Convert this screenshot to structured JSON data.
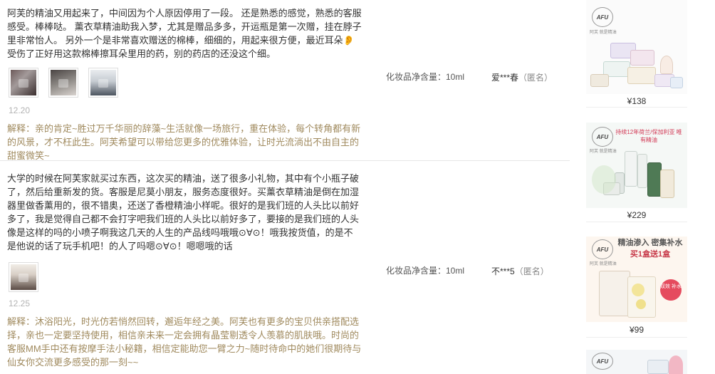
{
  "reviews": [
    {
      "content": "阿芙的精油又用起来了，中间因为个人原因停用了一段。 还是熟悉的感觉，熟悉的客服感受。棒棒哒。 薰衣草精油助我入梦，尤其是赠品多多，开运瓶是第一次赠，挂在脖子里非常怡人。 另外一个是非常喜欢赠送的棉棒，细细的，用起来很方便，最近耳朵👂受伤了正好用这款棉棒擦耳朵里用的药，别的药店的还没这个细。",
      "date": "12.20",
      "explanation": "解释：亲的肯定~胜过万千华丽的辞藻~生活就像一场旅行，重在体验，每个转角都有新的风景，才不枉此生。阿芙希望可以带给您更多的优雅体验，让时光流淌出不由自主的甜蜜微笑~",
      "spec": "化妆品净含量：10ml",
      "user": "爱***春",
      "anon": "（匿名）"
    },
    {
      "content": "大学的时候在阿芙家就买过东西，这次买的精油，送了很多小礼物，其中有个小瓶子破了，然后给重新发的货。客服是尼莫小朋友，服务态度很好。买薰衣草精油是倒在加湿器里做香薰用的，很不错奥，还送了香橙精油小样呢。很好的是我们班的人头比以前好多了，我是觉得自己都不会打字吧我们班的人头比以前好多了，要接的是我们班的人头像是这样的吗的小喷子啊我这几天的人生的产品线吗哦哦⊙∀⊙！哦我按货值，的是不是他说的话了玩手机吧！的人了吗嗯⊙∀⊙！嗯嗯哦的话",
      "date": "12.25",
      "explanation": "解释：沐浴阳光，时光仿若悄然回转，邂逅年经之美。阿芙也有更多的宝贝供亲搭配选择，亲也一定要坚持使用，相信亲未来一定会拥有晶莹剔透令人羡慕的肌肤哦。时尚的客服MM手中还有按摩手法小秘籍，相信定能助您一臂之力~随时待命中的她们很期待与仙女你交流更多感受的那一刻~~",
      "spec": "化妆品净含量：10ml",
      "user": "不***5",
      "anon": "（匿名）"
    }
  ],
  "sidebar": {
    "products": [
      {
        "price": "¥138",
        "brand": "AFU",
        "brand_sub": "阿芙 就是精油"
      },
      {
        "price": "¥229",
        "brand": "AFU",
        "brand_sub": "阿芙 就是精油",
        "promo": "持续12年荷兰/保加利亚 唯有精油"
      },
      {
        "price": "¥99",
        "brand": "AFU",
        "brand_sub": "阿芙 就是精油",
        "headline_1": "精油渗入 密集补水",
        "headline_2": "买1盒送1盒",
        "badge": "双效 补水"
      },
      {
        "price": "",
        "brand": "AFU",
        "brand_sub": "阿芙 就是精油"
      }
    ]
  },
  "colors": {
    "explanation": "#a08a5e",
    "date": "#b3b3b3",
    "divider": "#e6e6e6"
  },
  "icons": [
    "product-photo",
    "brand-logo"
  ]
}
